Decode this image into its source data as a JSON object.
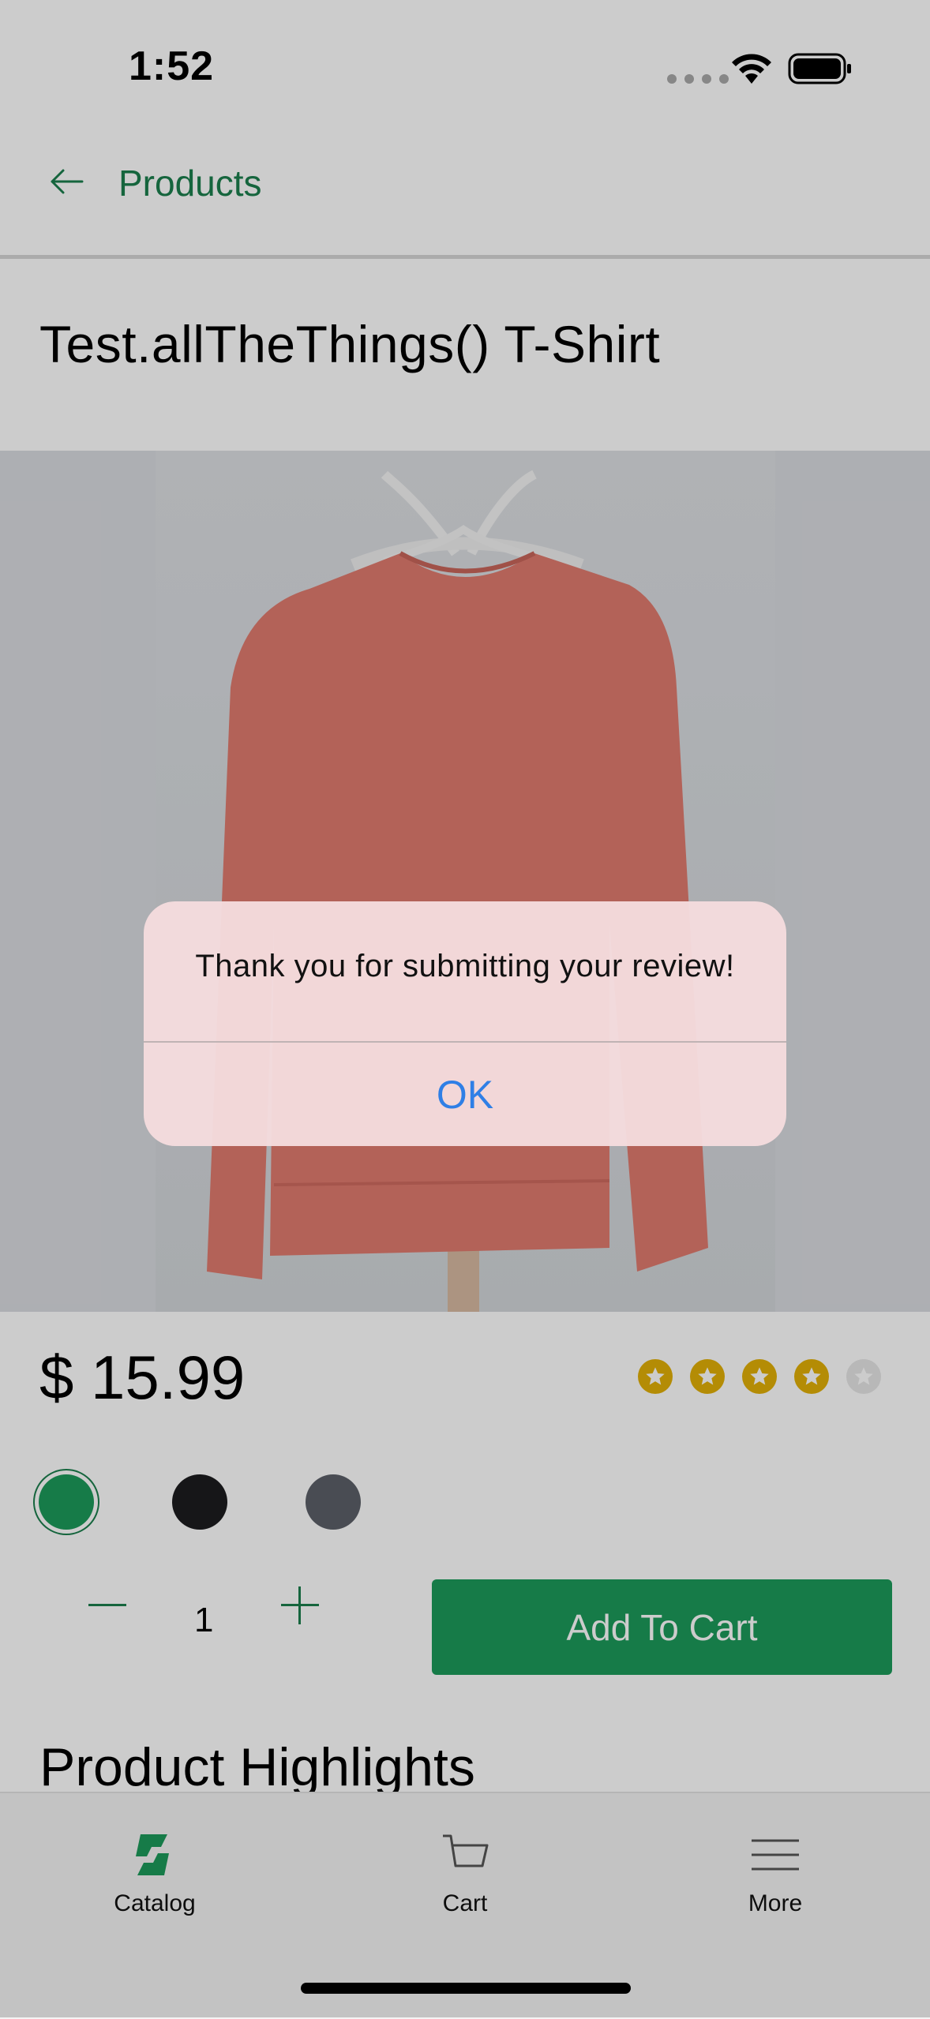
{
  "status_bar": {
    "time": "1:52"
  },
  "nav": {
    "back_label": "Products"
  },
  "product": {
    "title": "Test.allTheThings() T-Shirt",
    "price": "$ 15.99",
    "rating": 4,
    "rating_max": 5,
    "colors": [
      "#1c9a5b",
      "#1c1c1e",
      "#5c6068"
    ],
    "selected_color_index": 0,
    "quantity": "1",
    "add_to_cart_label": "Add To Cart",
    "shirt_color": "#e07b6f"
  },
  "section": {
    "highlights_title": "Product Highlights"
  },
  "tabs": [
    {
      "label": "Catalog",
      "icon": "catalog-logo-icon"
    },
    {
      "label": "Cart",
      "icon": "cart-icon"
    },
    {
      "label": "More",
      "icon": "menu-icon"
    }
  ],
  "alert": {
    "message": "Thank you for submitting your review!",
    "ok_label": "OK"
  },
  "colors": {
    "accent": "#1b7f4d",
    "button": "#1c9a5b",
    "star": "#e2b007",
    "link": "#2f7fe6"
  }
}
